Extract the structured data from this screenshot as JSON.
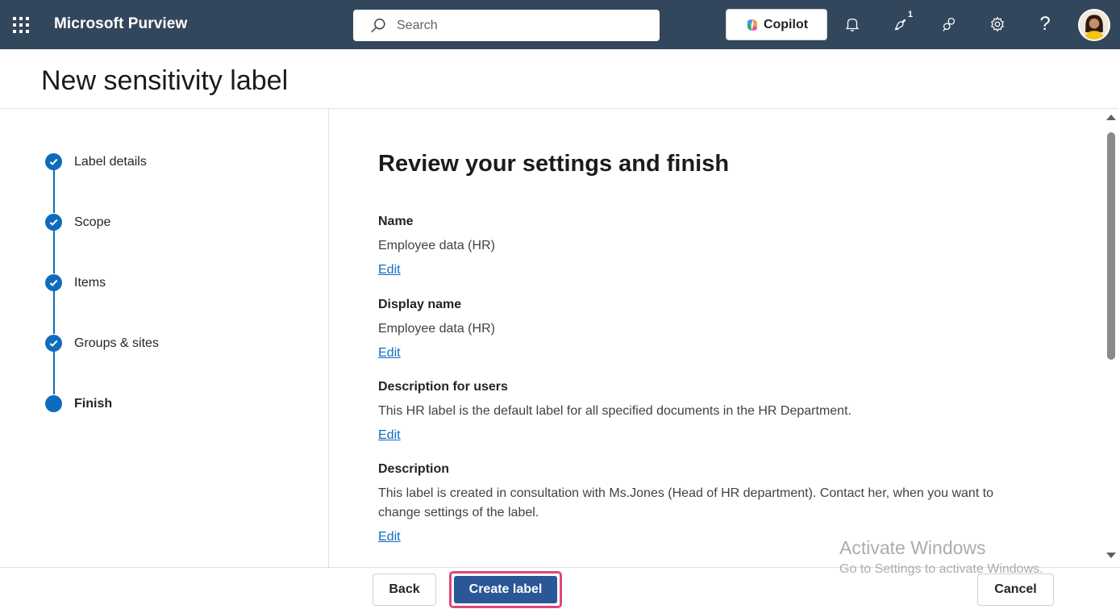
{
  "app": {
    "title": "Microsoft Purview"
  },
  "topbar": {
    "search_placeholder": "Search",
    "copilot_label": "Copilot",
    "notification_badge": "1",
    "help_glyph": "?",
    "icons": [
      "waffle-icon",
      "search-icon",
      "bell-icon",
      "feedback-icon",
      "connections-icon",
      "gear-icon",
      "help-icon",
      "avatar"
    ]
  },
  "page": {
    "title": "New sensitivity label"
  },
  "stepper": {
    "steps": [
      {
        "label": "Label details",
        "state": "completed"
      },
      {
        "label": "Scope",
        "state": "completed"
      },
      {
        "label": "Items",
        "state": "completed"
      },
      {
        "label": "Groups & sites",
        "state": "completed"
      },
      {
        "label": "Finish",
        "state": "current"
      }
    ]
  },
  "main": {
    "title": "Review your settings and finish",
    "sections": [
      {
        "label": "Name",
        "value": "Employee data (HR)",
        "edit": "Edit"
      },
      {
        "label": "Display name",
        "value": "Employee data (HR)",
        "edit": "Edit"
      },
      {
        "label": "Description for users",
        "value": "This HR label is the default label for all specified documents in the HR Department.",
        "edit": "Edit"
      },
      {
        "label": "Description",
        "value": "This label is created in consultation with Ms.Jones (Head of HR department). Contact her, when you want to change settings of the label.",
        "edit": "Edit"
      }
    ]
  },
  "footer": {
    "back_label": "Back",
    "create_label": "Create label",
    "cancel_label": "Cancel"
  },
  "watermark": {
    "title": "Activate Windows",
    "subtitle": "Go to Settings to activate Windows."
  },
  "colors": {
    "topbar": "#32475c",
    "accent": "#0f6cbd",
    "primary_button": "#2b5797",
    "highlight": "#e0457b"
  }
}
